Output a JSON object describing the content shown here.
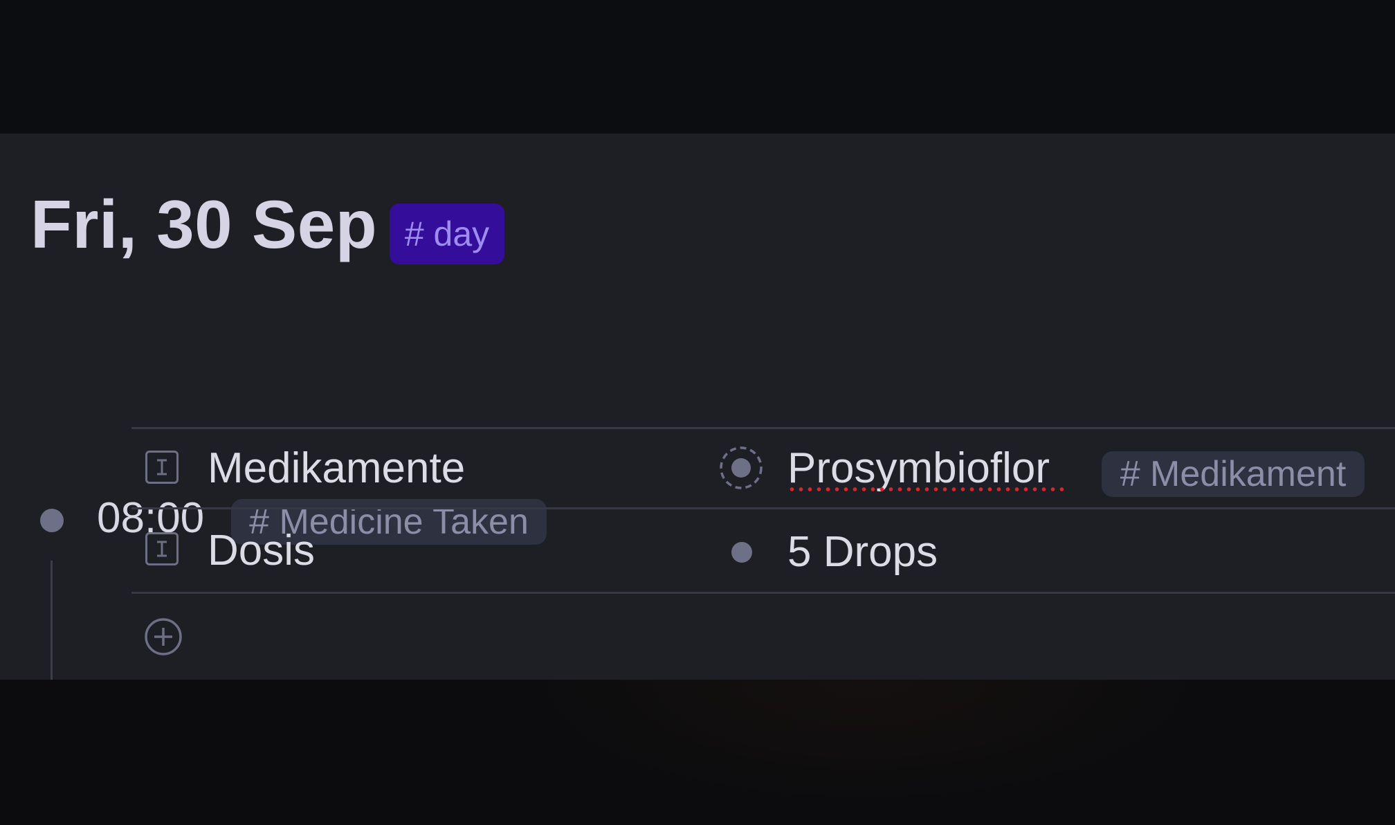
{
  "page": {
    "title": "Fri, 30 Sep",
    "title_tag": "# day",
    "colors": {
      "background": "#1e1f25",
      "day_tag_bg": "#350d9b",
      "day_tag_text": "#9f8cf1",
      "tag_bg": "#2e3140",
      "tag_text": "#8b8ea7",
      "spellcheck": "#d2282e"
    }
  },
  "entry": {
    "time": "08:00",
    "tag": "# Medicine Taken",
    "fields": [
      {
        "label": "Medikamente",
        "icon": "text-field-icon",
        "value": "Prosymbioflor",
        "value_icon": "reference-node-icon",
        "value_tag": "# Medikament"
      },
      {
        "label": "Dosis",
        "icon": "text-field-icon",
        "value": "5 Drops",
        "value_icon": "bullet-icon"
      }
    ],
    "add_icon": "add-field-icon"
  }
}
